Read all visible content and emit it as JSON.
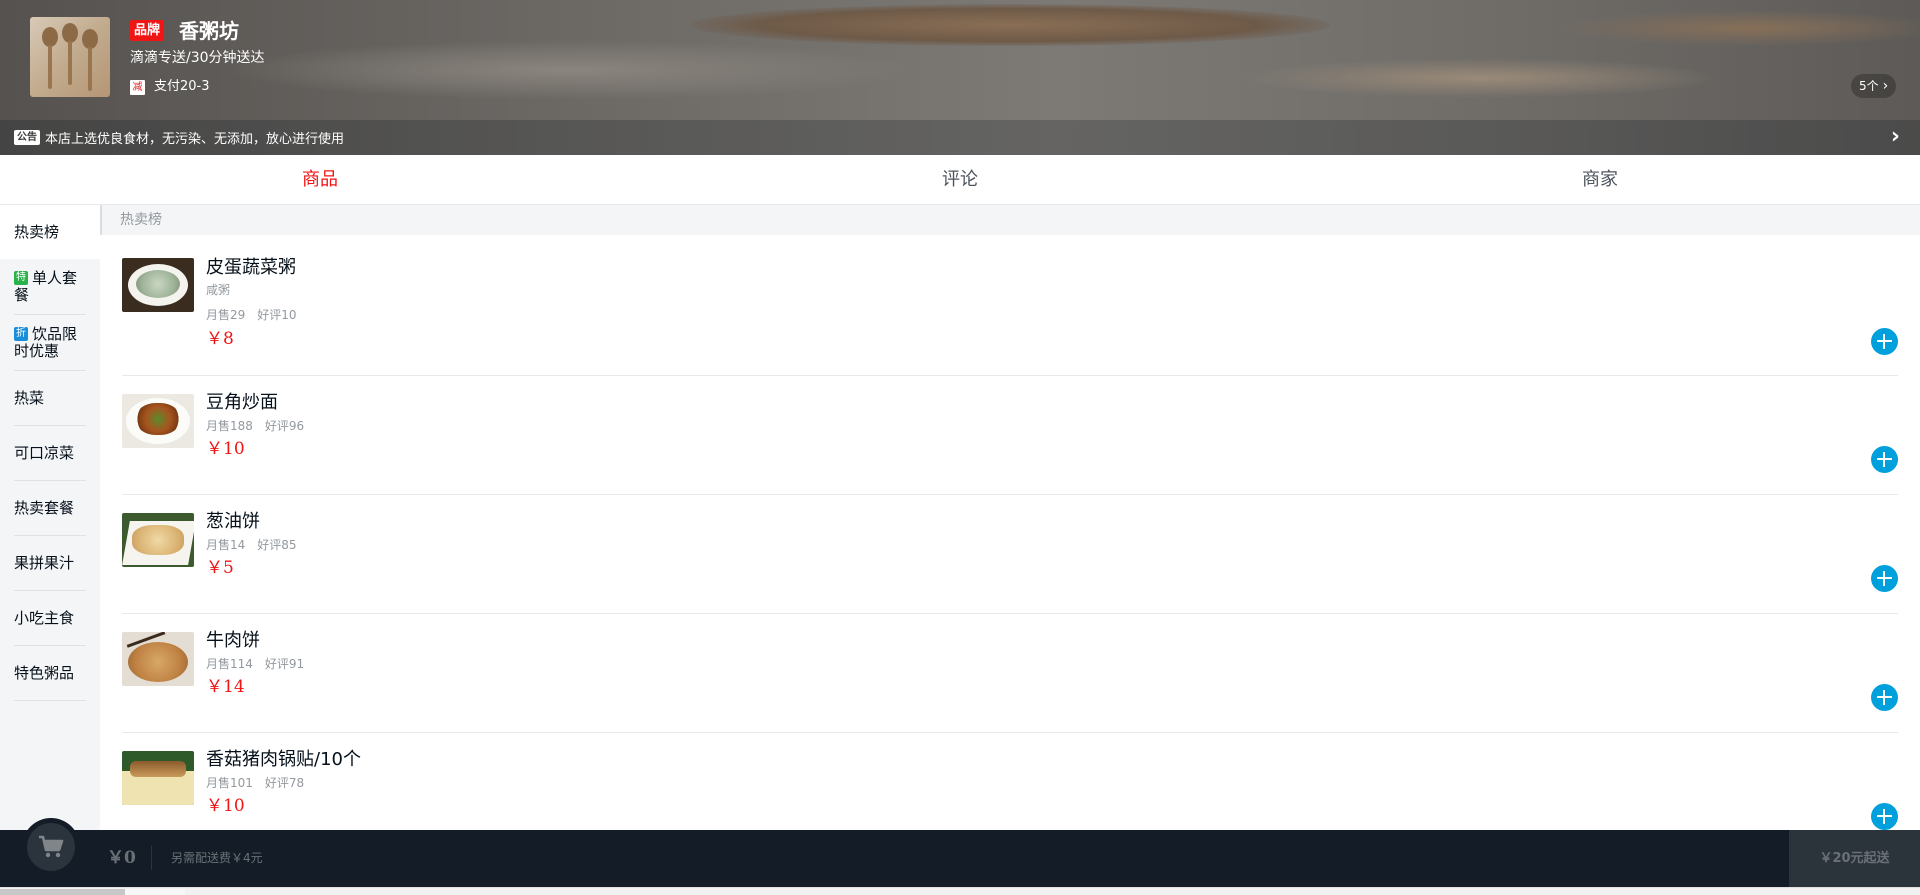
{
  "header": {
    "brand_badge": "品牌",
    "shop_name": "香粥坊",
    "delivery": "滴滴专送/30分钟送达",
    "promo_tag": "减",
    "promo_text": "支付20-3",
    "count_label": "5个",
    "notice_tag": "公告",
    "notice_text": "本店上选优良食材，无污染、无添加，放心进行使用"
  },
  "tabs": [
    {
      "label": "商品",
      "active": true
    },
    {
      "label": "评论",
      "active": false
    },
    {
      "label": "商家",
      "active": false
    }
  ],
  "menu": [
    {
      "label": "热卖榜",
      "icon": "",
      "active": true
    },
    {
      "label": "单人套餐",
      "icon": "特",
      "active": false
    },
    {
      "label": "饮品限时优惠",
      "icon": "折",
      "active": false
    },
    {
      "label": "热菜",
      "icon": "",
      "active": false
    },
    {
      "label": "可口凉菜",
      "icon": "",
      "active": false
    },
    {
      "label": "热卖套餐",
      "icon": "",
      "active": false
    },
    {
      "label": "果拼果汁",
      "icon": "",
      "active": false
    },
    {
      "label": "小吃主食",
      "icon": "",
      "active": false
    },
    {
      "label": "特色粥品",
      "icon": "",
      "active": false
    }
  ],
  "section_title": "热卖榜",
  "foods": [
    {
      "name": "皮蛋蔬菜粥",
      "desc": "咸粥",
      "sales": "月售29",
      "rating": "好评10",
      "price": "￥8"
    },
    {
      "name": "豆角炒面",
      "desc": "",
      "sales": "月售188",
      "rating": "好评96",
      "price": "￥10"
    },
    {
      "name": "葱油饼",
      "desc": "",
      "sales": "月售14",
      "rating": "好评85",
      "price": "￥5"
    },
    {
      "name": "牛肉饼",
      "desc": "",
      "sales": "月售114",
      "rating": "好评91",
      "price": "￥14"
    },
    {
      "name": "香菇猪肉锅贴/10个",
      "desc": "",
      "sales": "月售101",
      "rating": "好评78",
      "price": "￥10"
    }
  ],
  "cart": {
    "total": "￥0",
    "delivery_fee": "另需配送费￥4元",
    "min_order": "￥20元起送"
  },
  "colors": {
    "accent_red": "#f01414",
    "add_button": "#00a0dc",
    "cart_bar": "#141d27"
  }
}
